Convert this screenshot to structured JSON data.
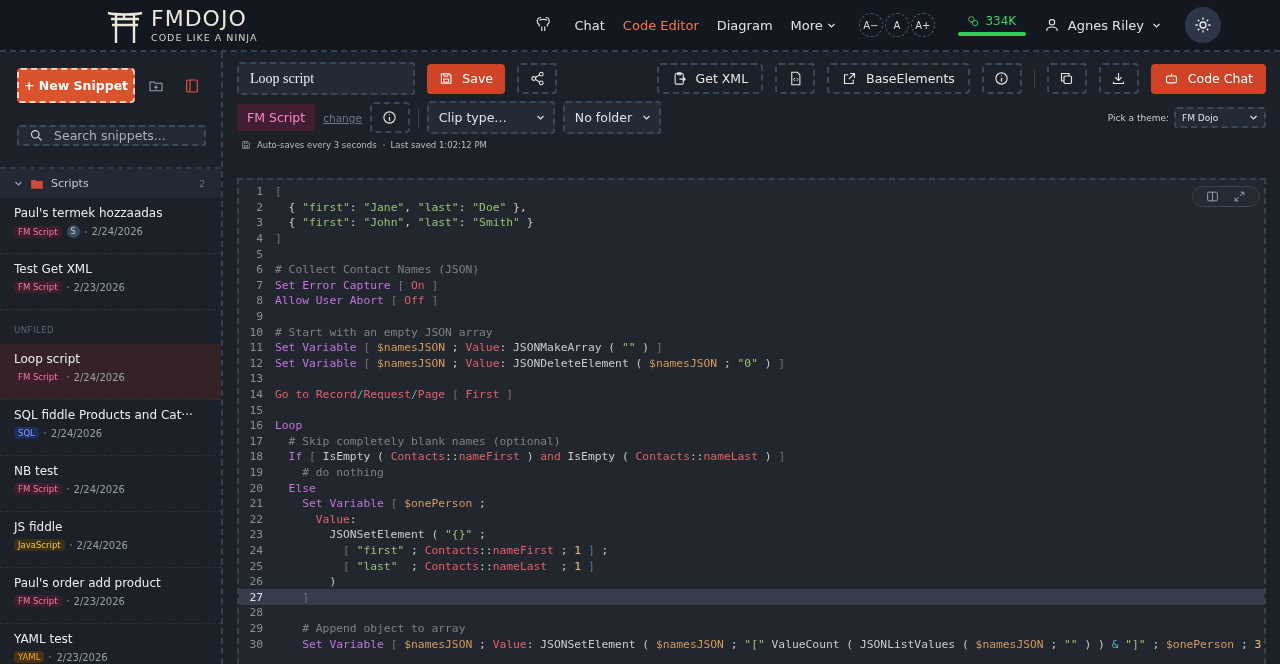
{
  "header": {
    "logo": {
      "title": "FMDOJO",
      "tagline": "CODE LIKE A NINJA"
    },
    "nav": [
      {
        "label": "Chat",
        "selected": false,
        "caret": false
      },
      {
        "label": "Code Editor",
        "selected": true,
        "caret": false
      },
      {
        "label": "Diagram",
        "selected": false,
        "caret": false
      },
      {
        "label": "More",
        "selected": false,
        "caret": true
      }
    ],
    "font_sizes": [
      "A−",
      "A",
      "A+"
    ],
    "credits": "334K",
    "user": "Agnes Riley"
  },
  "sidebar": {
    "new_button": "+ New Snippet",
    "search": {
      "placeholder": "Search snippets..."
    },
    "groups": [
      {
        "kind": "folder",
        "title": "Scripts",
        "count": "2",
        "expanded": true,
        "items": [
          {
            "title": "Paul's termek hozzaadas",
            "badge": {
              "label": "FM Script",
              "kind": "fm"
            },
            "avatar": "S",
            "date": "2/24/2026",
            "selected": false
          },
          {
            "title": "Test Get XML",
            "badge": {
              "label": "FM Script",
              "kind": "fm"
            },
            "date": "2/23/2026",
            "selected": false
          }
        ]
      },
      {
        "kind": "section",
        "title": "UNFILED",
        "items": [
          {
            "title": "Loop script",
            "badge": {
              "label": "FM Script",
              "kind": "fm"
            },
            "date": "2/24/2026",
            "selected": true
          },
          {
            "title": "SQL fiddle Products and Cat···",
            "badge": {
              "label": "SQL",
              "kind": "sql"
            },
            "date": "2/24/2026",
            "selected": false
          },
          {
            "title": "NB test",
            "badge": {
              "label": "FM Script",
              "kind": "fm"
            },
            "date": "2/24/2026",
            "selected": false
          },
          {
            "title": "JS fiddle",
            "badge": {
              "label": "JavaScript",
              "kind": "js"
            },
            "date": "2/24/2026",
            "selected": false
          },
          {
            "title": "Paul's order add product",
            "badge": {
              "label": "FM Script",
              "kind": "fm"
            },
            "date": "2/23/2026",
            "selected": false
          },
          {
            "title": "YAML test",
            "badge": {
              "label": "YAML",
              "kind": "yaml"
            },
            "date": "2/23/2026",
            "selected": false
          }
        ]
      }
    ]
  },
  "toolbar": {
    "title": "Loop script",
    "save": "Save",
    "get_xml": "Get XML",
    "base_elements": "BaseElements",
    "code_chat": "Code Chat",
    "language": "FM Script",
    "change_link": "change",
    "clip_type": "Clip type…",
    "folder": "No folder",
    "theme_label": "Pick a theme:",
    "theme": "FM Dojo",
    "autosave": "Auto-saves every 3 seconds",
    "last_saved": "Last saved 1:02:12 PM"
  },
  "editor": {
    "lines": [
      {
        "number": "1",
        "active": false,
        "tokens": [
          {
            "kind": "punct",
            "text": "["
          }
        ]
      },
      {
        "number": "2",
        "active": false,
        "tokens": [
          {
            "kind": "plain",
            "text": "  { "
          },
          {
            "kind": "str",
            "text": "\"first\""
          },
          {
            "kind": "plain",
            "text": ": "
          },
          {
            "kind": "str",
            "text": "\"Jane\""
          },
          {
            "kind": "plain",
            "text": ", "
          },
          {
            "kind": "str",
            "text": "\"last\""
          },
          {
            "kind": "plain",
            "text": ": "
          },
          {
            "kind": "str",
            "text": "\"Doe\""
          },
          {
            "kind": "plain",
            "text": " },"
          }
        ]
      },
      {
        "number": "3",
        "active": false,
        "tokens": [
          {
            "kind": "plain",
            "text": "  { "
          },
          {
            "kind": "str",
            "text": "\"first\""
          },
          {
            "kind": "plain",
            "text": ": "
          },
          {
            "kind": "str",
            "text": "\"John\""
          },
          {
            "kind": "plain",
            "text": ", "
          },
          {
            "kind": "str",
            "text": "\"last\""
          },
          {
            "kind": "plain",
            "text": ": "
          },
          {
            "kind": "str",
            "text": "\"Smith\""
          },
          {
            "kind": "plain",
            "text": " }"
          }
        ]
      },
      {
        "number": "4",
        "active": false,
        "tokens": [
          {
            "kind": "punct",
            "text": "]"
          }
        ]
      },
      {
        "number": "5",
        "active": false
      },
      {
        "number": "6",
        "active": false,
        "tokens": [
          {
            "kind": "cmt",
            "text": "# Collect Contact Names (JSON)"
          }
        ]
      },
      {
        "number": "7",
        "active": false,
        "tokens": [
          {
            "kind": "kw",
            "text": "Set Error Capture"
          },
          {
            "kind": "punct",
            "text": " [ "
          },
          {
            "kind": "opt",
            "text": "On"
          },
          {
            "kind": "punct",
            "text": " ]"
          }
        ]
      },
      {
        "number": "8",
        "active": false,
        "tokens": [
          {
            "kind": "kw",
            "text": "Allow User Abort"
          },
          {
            "kind": "punct",
            "text": " [ "
          },
          {
            "kind": "opt",
            "text": "Off"
          },
          {
            "kind": "punct",
            "text": " ]"
          }
        ]
      },
      {
        "number": "9",
        "active": false
      },
      {
        "number": "10",
        "active": false,
        "tokens": [
          {
            "kind": "cmt",
            "text": "# Start with an empty JSON array"
          }
        ]
      },
      {
        "number": "11",
        "active": false,
        "tokens": [
          {
            "kind": "kw",
            "text": "Set Variable"
          },
          {
            "kind": "punct",
            "text": " [ "
          },
          {
            "kind": "var",
            "text": "$namesJSON"
          },
          {
            "kind": "plain",
            "text": " ; "
          },
          {
            "kind": "opt",
            "text": "Value"
          },
          {
            "kind": "plain",
            "text": ": JSONMakeArray ( "
          },
          {
            "kind": "str",
            "text": "\"\""
          },
          {
            "kind": "plain",
            "text": " ) "
          },
          {
            "kind": "punct",
            "text": "]"
          }
        ]
      },
      {
        "number": "12",
        "active": false,
        "tokens": [
          {
            "kind": "kw",
            "text": "Set Variable"
          },
          {
            "kind": "punct",
            "text": " [ "
          },
          {
            "kind": "var",
            "text": "$namesJSON"
          },
          {
            "kind": "plain",
            "text": " ; "
          },
          {
            "kind": "opt",
            "text": "Value"
          },
          {
            "kind": "plain",
            "text": ": JSONDeleteElement ( "
          },
          {
            "kind": "var",
            "text": "$namesJSON"
          },
          {
            "kind": "plain",
            "text": " ; "
          },
          {
            "kind": "str",
            "text": "\"0\""
          },
          {
            "kind": "plain",
            "text": " ) "
          },
          {
            "kind": "punct",
            "text": "]"
          }
        ]
      },
      {
        "number": "13",
        "active": false
      },
      {
        "number": "14",
        "active": false,
        "tokens": [
          {
            "kind": "opt",
            "text": "Go to Record"
          },
          {
            "kind": "op",
            "text": "/"
          },
          {
            "kind": "opt",
            "text": "Request"
          },
          {
            "kind": "op",
            "text": "/"
          },
          {
            "kind": "opt",
            "text": "Page"
          },
          {
            "kind": "punct",
            "text": " [ "
          },
          {
            "kind": "opt",
            "text": "First"
          },
          {
            "kind": "punct",
            "text": " ]"
          }
        ]
      },
      {
        "number": "15",
        "active": false
      },
      {
        "number": "16",
        "active": false,
        "tokens": [
          {
            "kind": "kw",
            "text": "Loop"
          }
        ]
      },
      {
        "number": "17",
        "active": false,
        "tokens": [
          {
            "kind": "cmt",
            "text": "  # Skip completely blank names (optional)"
          }
        ]
      },
      {
        "number": "18",
        "active": false,
        "tokens": [
          {
            "kind": "kw",
            "text": "  If"
          },
          {
            "kind": "punct",
            "text": " [ "
          },
          {
            "kind": "plain",
            "text": "IsEmpty ( "
          },
          {
            "kind": "opt",
            "text": "Contacts"
          },
          {
            "kind": "plain",
            "text": "::"
          },
          {
            "kind": "opt",
            "text": "nameFirst"
          },
          {
            "kind": "plain",
            "text": " ) "
          },
          {
            "kind": "opt",
            "text": "and"
          },
          {
            "kind": "plain",
            "text": " IsEmpty ( "
          },
          {
            "kind": "opt",
            "text": "Contacts"
          },
          {
            "kind": "plain",
            "text": "::"
          },
          {
            "kind": "opt",
            "text": "nameLast"
          },
          {
            "kind": "plain",
            "text": " ) "
          },
          {
            "kind": "punct",
            "text": "]"
          }
        ]
      },
      {
        "number": "19",
        "active": false,
        "tokens": [
          {
            "kind": "cmt",
            "text": "    # do nothing"
          }
        ]
      },
      {
        "number": "20",
        "active": false,
        "tokens": [
          {
            "kind": "kw",
            "text": "  Else"
          }
        ]
      },
      {
        "number": "21",
        "active": false,
        "tokens": [
          {
            "kind": "kw",
            "text": "    Set Variable"
          },
          {
            "kind": "punct",
            "text": " [ "
          },
          {
            "kind": "var",
            "text": "$onePerson"
          },
          {
            "kind": "plain",
            "text": " ;"
          }
        ]
      },
      {
        "number": "22",
        "active": false,
        "tokens": [
          {
            "kind": "opt",
            "text": "      Value"
          },
          {
            "kind": "plain",
            "text": ":"
          }
        ]
      },
      {
        "number": "23",
        "active": false,
        "tokens": [
          {
            "kind": "plain",
            "text": "        JSONSetElement ( "
          },
          {
            "kind": "str",
            "text": "\"{}\""
          },
          {
            "kind": "plain",
            "text": " ;"
          }
        ]
      },
      {
        "number": "24",
        "active": false,
        "tokens": [
          {
            "kind": "punct",
            "text": "          [ "
          },
          {
            "kind": "str",
            "text": "\"first\""
          },
          {
            "kind": "plain",
            "text": " ; "
          },
          {
            "kind": "opt",
            "text": "Contacts"
          },
          {
            "kind": "plain",
            "text": "::"
          },
          {
            "kind": "opt",
            "text": "nameFirst"
          },
          {
            "kind": "plain",
            "text": " ; "
          },
          {
            "kind": "num",
            "text": "1"
          },
          {
            "kind": "punct",
            "text": " ]"
          },
          {
            "kind": "plain",
            "text": " ;"
          }
        ]
      },
      {
        "number": "25",
        "active": false,
        "tokens": [
          {
            "kind": "punct",
            "text": "          [ "
          },
          {
            "kind": "str",
            "text": "\"last\""
          },
          {
            "kind": "plain",
            "text": "  ; "
          },
          {
            "kind": "opt",
            "text": "Contacts"
          },
          {
            "kind": "plain",
            "text": "::"
          },
          {
            "kind": "opt",
            "text": "nameLast"
          },
          {
            "kind": "plain",
            "text": "  ; "
          },
          {
            "kind": "num",
            "text": "1"
          },
          {
            "kind": "punct",
            "text": " ]"
          }
        ]
      },
      {
        "number": "26",
        "active": false,
        "tokens": [
          {
            "kind": "plain",
            "text": "        )"
          }
        ]
      },
      {
        "number": "27",
        "active": true,
        "tokens": [
          {
            "kind": "punct",
            "text": "    ]"
          }
        ]
      },
      {
        "number": "28",
        "active": false
      },
      {
        "number": "29",
        "active": false,
        "tokens": [
          {
            "kind": "cmt",
            "text": "    # Append object to array"
          }
        ]
      },
      {
        "number": "30",
        "active": false,
        "tokens": [
          {
            "kind": "kw",
            "text": "    Set Variable"
          },
          {
            "kind": "punct",
            "text": " [ "
          },
          {
            "kind": "var",
            "text": "$namesJSON"
          },
          {
            "kind": "plain",
            "text": " ; "
          },
          {
            "kind": "opt",
            "text": "Value"
          },
          {
            "kind": "plain",
            "text": ": JSONSetElement ( "
          },
          {
            "kind": "var",
            "text": "$namesJSON"
          },
          {
            "kind": "plain",
            "text": " ; "
          },
          {
            "kind": "str",
            "text": "\"[\""
          },
          {
            "kind": "plain",
            "text": " ValueCount ( JSONListValues ( "
          },
          {
            "kind": "var",
            "text": "$namesJSON"
          },
          {
            "kind": "plain",
            "text": " ; "
          },
          {
            "kind": "str",
            "text": "\"\""
          },
          {
            "kind": "plain",
            "text": " ) ) "
          },
          {
            "kind": "op",
            "text": "&"
          },
          {
            "kind": "str",
            "text": " \"]\""
          },
          {
            "kind": "plain",
            "text": " ; "
          },
          {
            "kind": "var",
            "text": "$onePerson"
          },
          {
            "kind": "plain",
            "text": " ; "
          },
          {
            "kind": "num",
            "text": "3"
          }
        ]
      }
    ]
  }
}
